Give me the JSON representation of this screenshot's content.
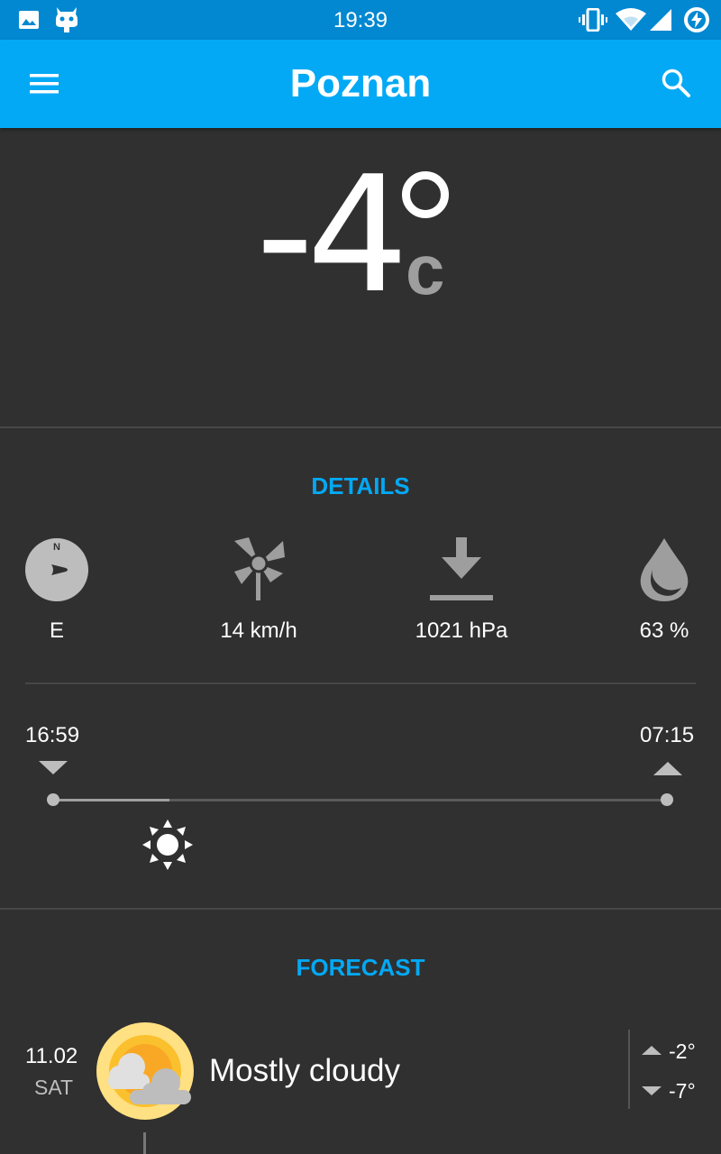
{
  "status_bar": {
    "time": "19:39",
    "left_icons": [
      "image-icon",
      "cyanogen-bot-icon"
    ],
    "right_icons": [
      "vibrate-icon",
      "wifi-icon",
      "signal-icon",
      "battery-charging-icon"
    ]
  },
  "app_bar": {
    "title": "Poznan",
    "menu_icon": "menu-icon",
    "search_icon": "search-icon"
  },
  "current": {
    "temperature": "-4",
    "unit": "c"
  },
  "details": {
    "title": "DETAILS",
    "wind_direction": "E",
    "wind_speed": "14 km/h",
    "pressure": "1021 hPa",
    "humidity": "63 %"
  },
  "sun": {
    "sunset": "16:59",
    "sunrise": "07:15",
    "progress": 0.19
  },
  "forecast": {
    "title": "FORECAST",
    "items": [
      {
        "date": "11.02",
        "day": "SAT",
        "description": "Mostly cloudy",
        "high": "-2°",
        "low": "-7°",
        "icon": "partly-cloudy-icon"
      }
    ]
  },
  "colors": {
    "primary": "#03A9F4",
    "primary_dark": "#0288D1",
    "background": "#303030",
    "accent_text": "#03A9F4"
  }
}
